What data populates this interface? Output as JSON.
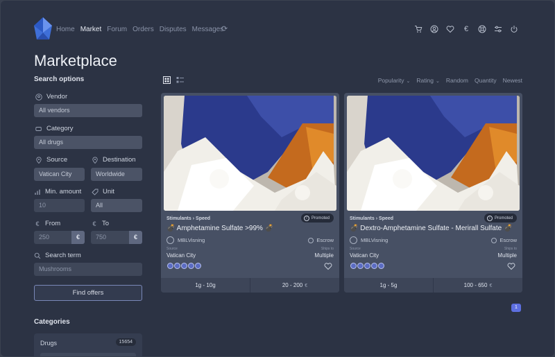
{
  "nav": {
    "items": [
      {
        "label": "Home",
        "active": false
      },
      {
        "label": "Market",
        "active": true
      },
      {
        "label": "Forum",
        "active": false
      },
      {
        "label": "Orders",
        "active": false
      },
      {
        "label": "Disputes",
        "active": false
      },
      {
        "label": "Messages",
        "active": false
      }
    ],
    "header_icons": [
      "cart-icon",
      "user-icon",
      "heart-icon",
      "euro-icon",
      "support-icon",
      "settings-icon",
      "power-icon"
    ],
    "euro_symbol": "€"
  },
  "page": {
    "title": "Marketplace"
  },
  "search": {
    "title": "Search options",
    "vendor_label": "Vendor",
    "vendor_value": "All vendors",
    "category_label": "Category",
    "category_value": "All drugs",
    "source_label": "Source",
    "source_value": "Vatican City",
    "destination_label": "Destination",
    "destination_value": "Worldwide",
    "min_amount_label": "Min. amount",
    "min_amount_value": "10",
    "unit_label": "Unit",
    "unit_value": "All",
    "from_label": "From",
    "from_value": "250",
    "to_label": "To",
    "to_value": "750",
    "currency": "€",
    "term_label": "Search term",
    "term_value": "Mushrooms",
    "find_button": "Find offers"
  },
  "categories": {
    "title": "Categories",
    "items": [
      {
        "label": "Drugs",
        "count": "15654"
      }
    ]
  },
  "toolbar": {
    "sorts": [
      "Popularity",
      "Rating",
      "Random",
      "Quantity",
      "Newest"
    ]
  },
  "listings": [
    {
      "category": "Stimulants",
      "subcategory": "Speed",
      "badge": "Promoted",
      "name": "💣 Amphetamine Sulfate >99% 💣",
      "vendor": "MBLVisning",
      "payment": "Escrow",
      "source_label": "Source",
      "source": "Vatican City",
      "ships_label": "Ships to",
      "ships_to": "Multiple",
      "rating": 5,
      "amount_range": "1g - 10g",
      "price_range": "20 - 200",
      "currency": "€"
    },
    {
      "category": "Stimulants",
      "subcategory": "Speed",
      "badge": "Promoted",
      "name": "💣 Dextro-Amphetamine Sulfate - Merirall Sulfate 💣",
      "vendor": "MBLVisning",
      "payment": "Escrow",
      "source_label": "Source",
      "source": "Vatican City",
      "ships_label": "Ships to",
      "ships_to": "Multiple",
      "rating": 5,
      "amount_range": "1g - 5g",
      "price_range": "100 - 650",
      "currency": "€"
    }
  ],
  "pagination": {
    "current": "1"
  },
  "colors": {
    "accent": "#5d6fe0",
    "background": "#2c3344",
    "card": "#475064"
  }
}
